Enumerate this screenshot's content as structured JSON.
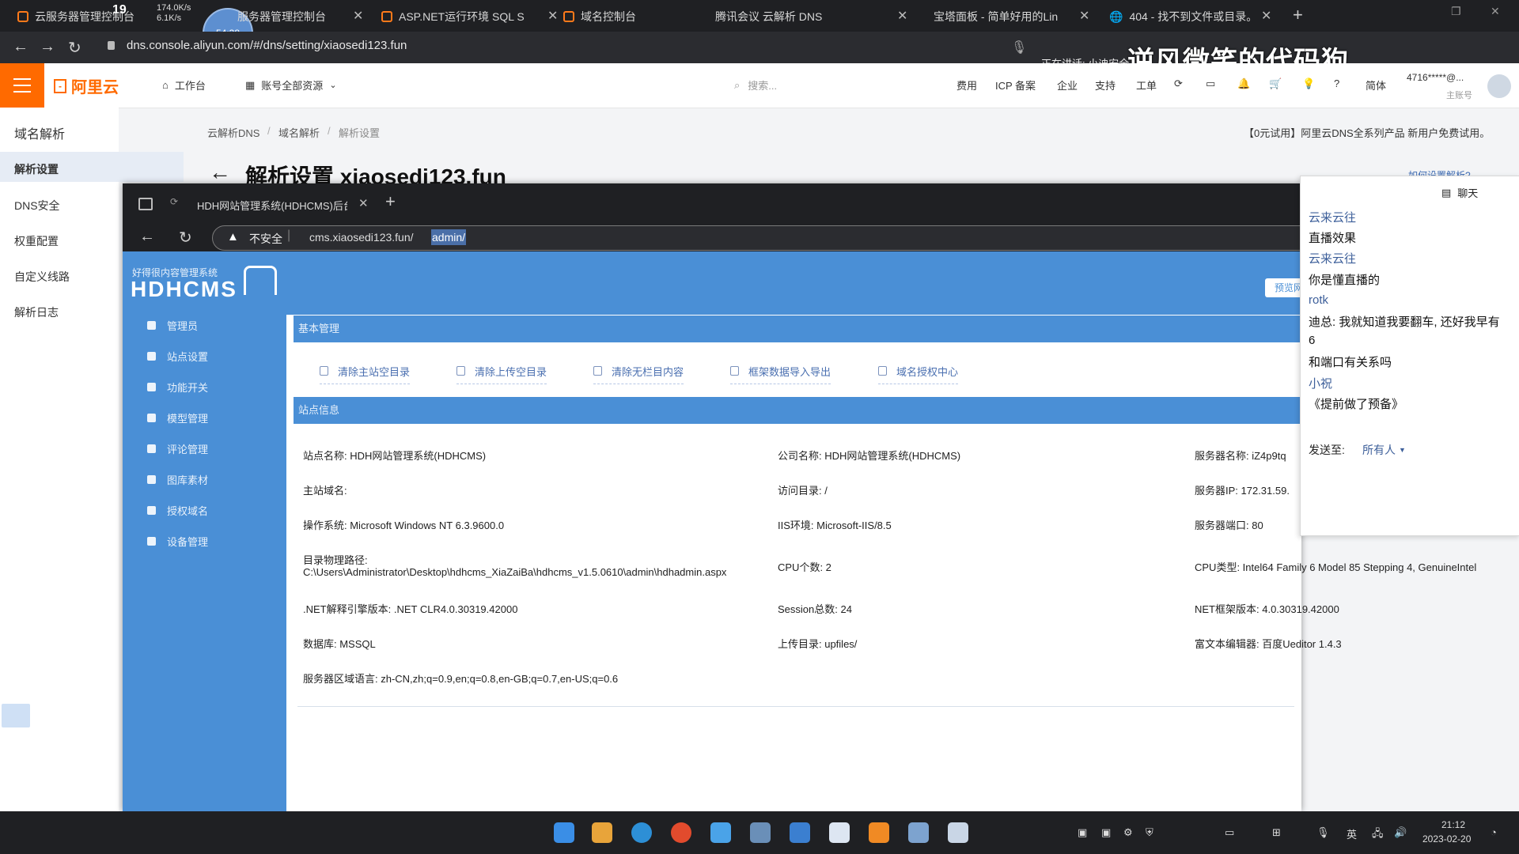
{
  "outer_tabs": [
    {
      "title": "云服务器管理控制台"
    },
    {
      "title": "服务器管理控制台"
    },
    {
      "title": "ASP.NET运行环境 SQL S"
    },
    {
      "title": "域名控制台"
    },
    {
      "title": "腾讯会议 云解析 DNS"
    },
    {
      "title": "宝塔面板 - 简单好用的Lin"
    },
    {
      "title": "404 - 找不到文件或目录。"
    }
  ],
  "net_speed": {
    "up": "174.0K/s",
    "down": "6.1K/s"
  },
  "counter_badge": "19",
  "timer_badge": "54:38",
  "outer_url": "dns.console.aliyun.com/#/dns/setting/xiaosedi123.fun",
  "speaking_text": "正在讲话: 小迪安全",
  "overlay_title": "逆风微笑的代码狗",
  "aliyun_header": {
    "brand": "阿里云",
    "workbench": "工作台",
    "resources": "账号全部资源",
    "search_placeholder": "搜索...",
    "links": [
      "费用",
      "ICP 备案",
      "企业",
      "支持",
      "工单"
    ],
    "lang": "简体",
    "account": "4716*****@...",
    "account_role": "主账号"
  },
  "aliyun_side": {
    "title": "域名解析",
    "items": [
      "解析设置",
      "DNS安全",
      "权重配置",
      "自定义线路",
      "解析日志"
    ]
  },
  "breadcrumb": [
    "云解析DNS",
    "域名解析",
    "解析设置"
  ],
  "promo": "【0元试用】阿里云DNS全系列产品 新用户免费试用。",
  "page_title": "解析设置 xiaosedi123.fun",
  "help_link": "如何设置解析?",
  "inner_browser": {
    "tab_title": "HDH网站管理系统(HDHCMS)后台",
    "insecure": "不安全",
    "url_host": "cms.xiaosedi123.fun/",
    "url_path": "admin/"
  },
  "cms": {
    "logo_small": "好得很内容管理系统",
    "logo_big": "HDHCMS",
    "preview": "预览网",
    "menu": [
      "管理员",
      "站点设置",
      "功能开关",
      "模型管理",
      "评论管理",
      "图库素材",
      "授权域名",
      "设备管理"
    ],
    "bar1": "基本管理",
    "buttons": [
      "清除主站空目录",
      "清除上传空目录",
      "清除无栏目内容",
      "框架数据导入导出",
      "域名授权中心"
    ],
    "bar2": "站点信息",
    "info": {
      "site_name": "站点名称: HDH网站管理系统(HDHCMS)",
      "company": "公司名称: HDH网站管理系统(HDHCMS)",
      "server_name": "服务器名称: iZ4p9tq",
      "main_domain": "主站域名:",
      "visit_dir": "访问目录: /",
      "server_ip": "服务器IP: 172.31.59.",
      "os": "操作系统: Microsoft Windows NT 6.3.9600.0",
      "iis": "IIS环境: Microsoft-IIS/8.5",
      "port": "服务器端口: 80",
      "path_label": "目录物理路径:",
      "path_value": "C:\\Users\\Administrator\\Desktop\\hdhcms_XiaZaiBa\\hdhcms_v1.5.0610\\admin\\hdhadmin.aspx",
      "cpu_count": "CPU个数: 2",
      "cpu_type": "CPU类型: Intel64 Family 6 Model 85 Stepping 4, GenuineIntel",
      "net_engine": ".NET解释引擎版本: .NET CLR4.0.30319.42000",
      "session": "Session总数: 24",
      "net_framework": "NET框架版本: 4.0.30319.42000",
      "database": "数据库: MSSQL",
      "upload_dir": "上传目录: upfiles/",
      "editor": "富文本编辑器: 百度Ueditor 1.4.3",
      "server_lang": "服务器区域语言: zh-CN,zh;q=0.9,en;q=0.8,en-GB;q=0.7,en-US;q=0.6"
    }
  },
  "chat": {
    "title": "聊天",
    "messages": [
      {
        "name": "云来云往",
        "text": "直播效果"
      },
      {
        "name": "云来云往",
        "text": "你是懂直播的"
      },
      {
        "name": "rotk",
        "text": "迪总: 我就知道我要翻车, 还好我早有"
      },
      {
        "name": "",
        "text": "6"
      },
      {
        "name": "",
        "text": "和端口有关系吗"
      },
      {
        "name": "小祝",
        "text": "《提前做了预备》"
      }
    ],
    "send_to_label": "发送至:",
    "send_to_value": "所有人"
  },
  "taskbar": {
    "ime": "英",
    "time": "21:12",
    "date": "2023-02-20"
  },
  "colors": {
    "aliyun_orange": "#ff6a00",
    "cms_blue": "#4a8fd6",
    "chrome_dark": "#1f2023"
  }
}
